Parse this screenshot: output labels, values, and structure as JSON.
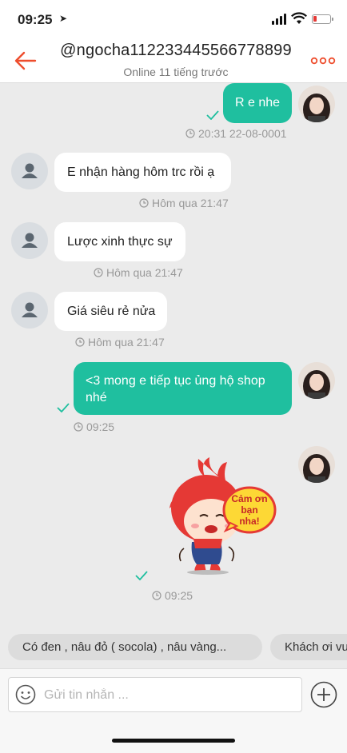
{
  "status": {
    "time": "09:25"
  },
  "header": {
    "title": "@ngocha112233445566778899",
    "subtitle": "Online 11 tiếng trước"
  },
  "messages": [
    {
      "dir": "out",
      "text": "R e nhe",
      "time": "20:31 22-08-0001"
    },
    {
      "dir": "in",
      "text": "E nhận hàng hôm trc rồi ạ",
      "time": "Hôm qua 21:47"
    },
    {
      "dir": "in",
      "text": "Lược xinh thực sự",
      "time": "Hôm qua 21:47"
    },
    {
      "dir": "in",
      "text": "Giá siêu rẻ nửa",
      "time": "Hôm qua 21:47"
    },
    {
      "dir": "out",
      "text": "<3 mong e tiếp tục ủng hộ shop nhé",
      "time": "09:25"
    },
    {
      "dir": "out",
      "sticker_text": "Cảm ơn bạn nha!",
      "time": "09:25"
    }
  ],
  "quick_replies": [
    "Có đen , nâu đỏ ( socola) , nâu vàng...",
    "Khách ơi vu"
  ],
  "input": {
    "placeholder": "Gửi tin nhắn ..."
  },
  "colors": {
    "accent": "#1fbf9f",
    "brand": "#ee4d2d"
  }
}
